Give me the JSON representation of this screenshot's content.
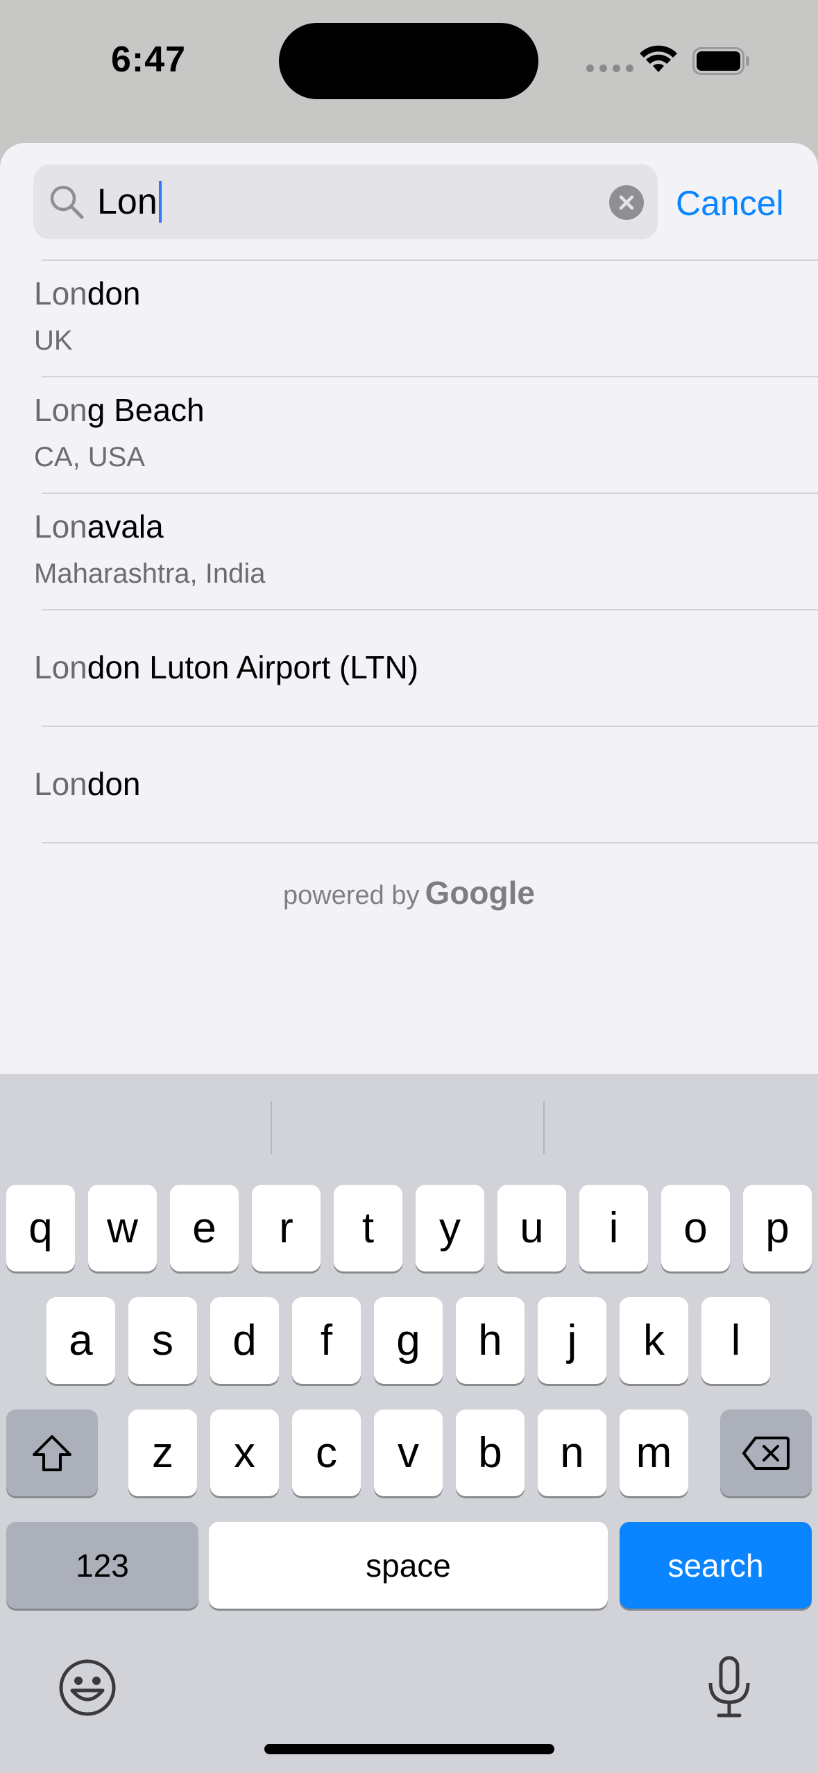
{
  "status": {
    "time": "6:47"
  },
  "search": {
    "query": "Lon",
    "cancel_label": "Cancel"
  },
  "results": [
    {
      "match": "Lon",
      "rest": "don",
      "subtitle": "UK"
    },
    {
      "match": "Lon",
      "rest": "g Beach",
      "subtitle": "CA, USA"
    },
    {
      "match": "Lon",
      "rest": "avala",
      "subtitle": "Maharashtra, India"
    },
    {
      "match": "Lon",
      "rest": "don Luton Airport (LTN)",
      "subtitle": ""
    },
    {
      "match": "Lon",
      "rest": "don",
      "subtitle": ""
    }
  ],
  "attribution": {
    "prefix": "powered by",
    "brand": "Google"
  },
  "keyboard": {
    "row1": [
      "q",
      "w",
      "e",
      "r",
      "t",
      "y",
      "u",
      "i",
      "o",
      "p"
    ],
    "row2": [
      "a",
      "s",
      "d",
      "f",
      "g",
      "h",
      "j",
      "k",
      "l"
    ],
    "row3": [
      "z",
      "x",
      "c",
      "v",
      "b",
      "n",
      "m"
    ],
    "numbers_label": "123",
    "space_label": "space",
    "search_label": "search"
  },
  "colors": {
    "accent": "#0a84ff",
    "caret": "#3478f6"
  }
}
